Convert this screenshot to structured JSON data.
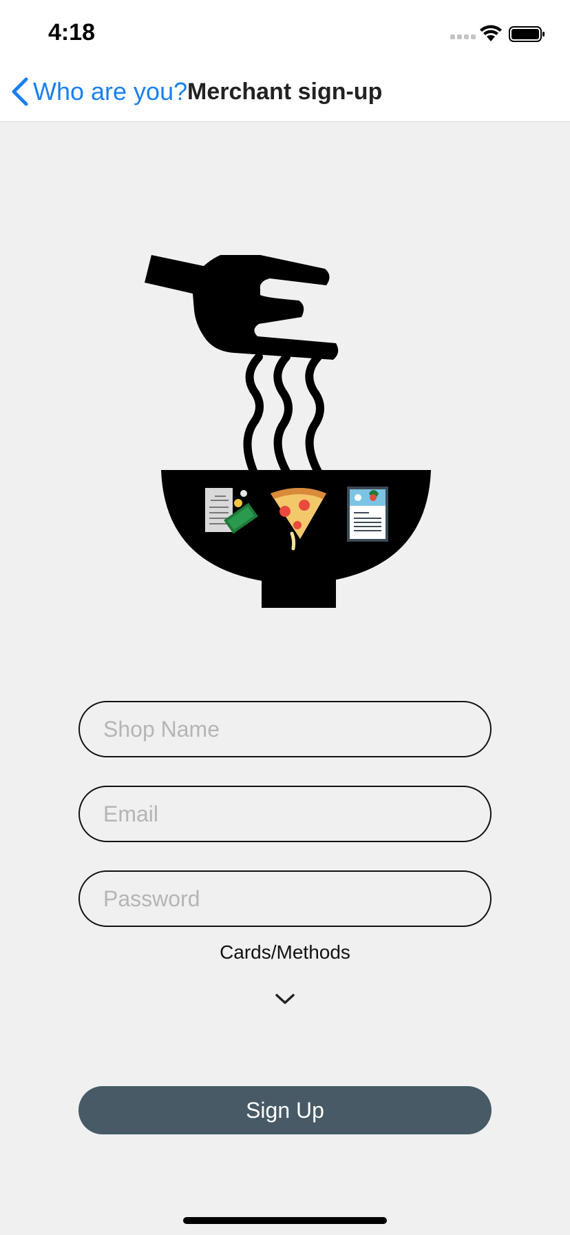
{
  "status_bar": {
    "time": "4:18",
    "icons": [
      "cellular-signal-icon",
      "wifi-icon",
      "battery-icon"
    ]
  },
  "nav": {
    "back_label": "Who are you?",
    "title": "Merchant sign-up",
    "accent_color": "#1a7ff0"
  },
  "logo": {
    "icons": [
      "fork-icon",
      "noodle-bowl-icon",
      "receipt-money-icon",
      "pizza-slice-icon",
      "menu-card-icon"
    ]
  },
  "form": {
    "shop_name_placeholder": "Shop Name",
    "shop_name_value": "",
    "email_placeholder": "Email",
    "email_value": "",
    "password_placeholder": "Password",
    "password_value": "",
    "methods_label": "Cards/Methods",
    "signup_label": "Sign Up",
    "signup_color": "#475a65"
  }
}
